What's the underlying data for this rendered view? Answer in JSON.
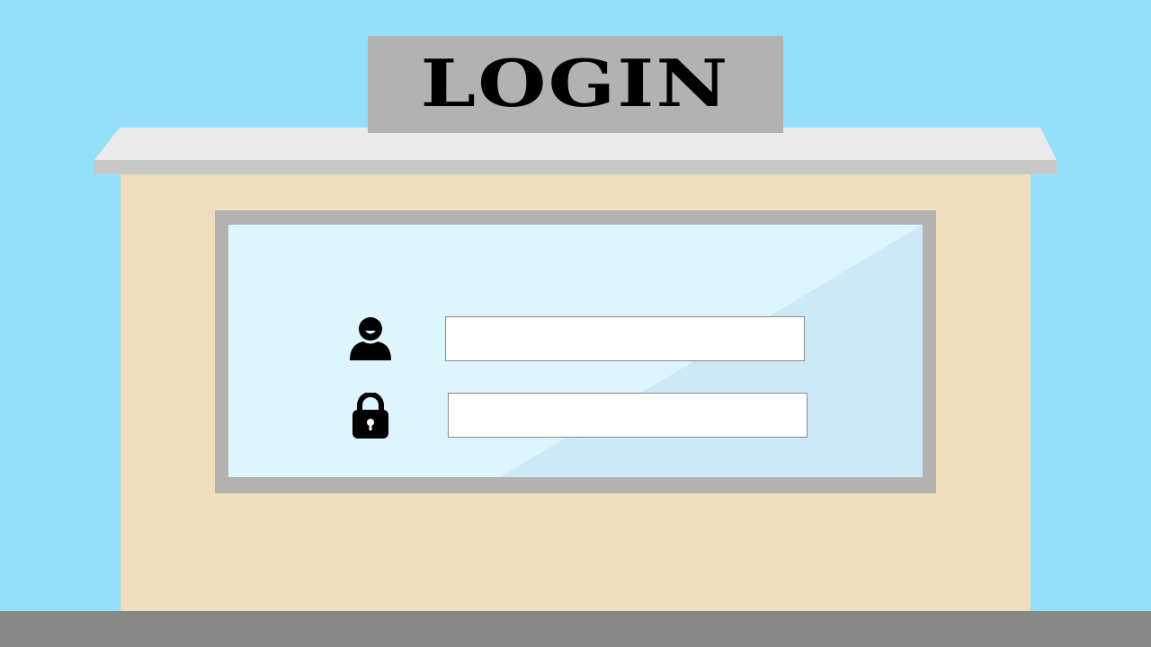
{
  "sign": {
    "title": "LOGIN"
  },
  "form": {
    "username": {
      "value": "",
      "placeholder": ""
    },
    "password": {
      "value": "",
      "placeholder": ""
    }
  },
  "icons": {
    "username": "user-icon",
    "password": "lock-icon"
  },
  "colors": {
    "sky": "#94e0fa",
    "ground": "#888888",
    "wall": "#efe0bd",
    "roof_top": "#ebebeb",
    "roof_edge": "#c8c8c8",
    "sign_board": "#b2b2b2",
    "window_frame": "#b2b2b2",
    "glass": "#ddf6fe",
    "glass_reflection": "#cde8f6",
    "text": "#000000"
  }
}
